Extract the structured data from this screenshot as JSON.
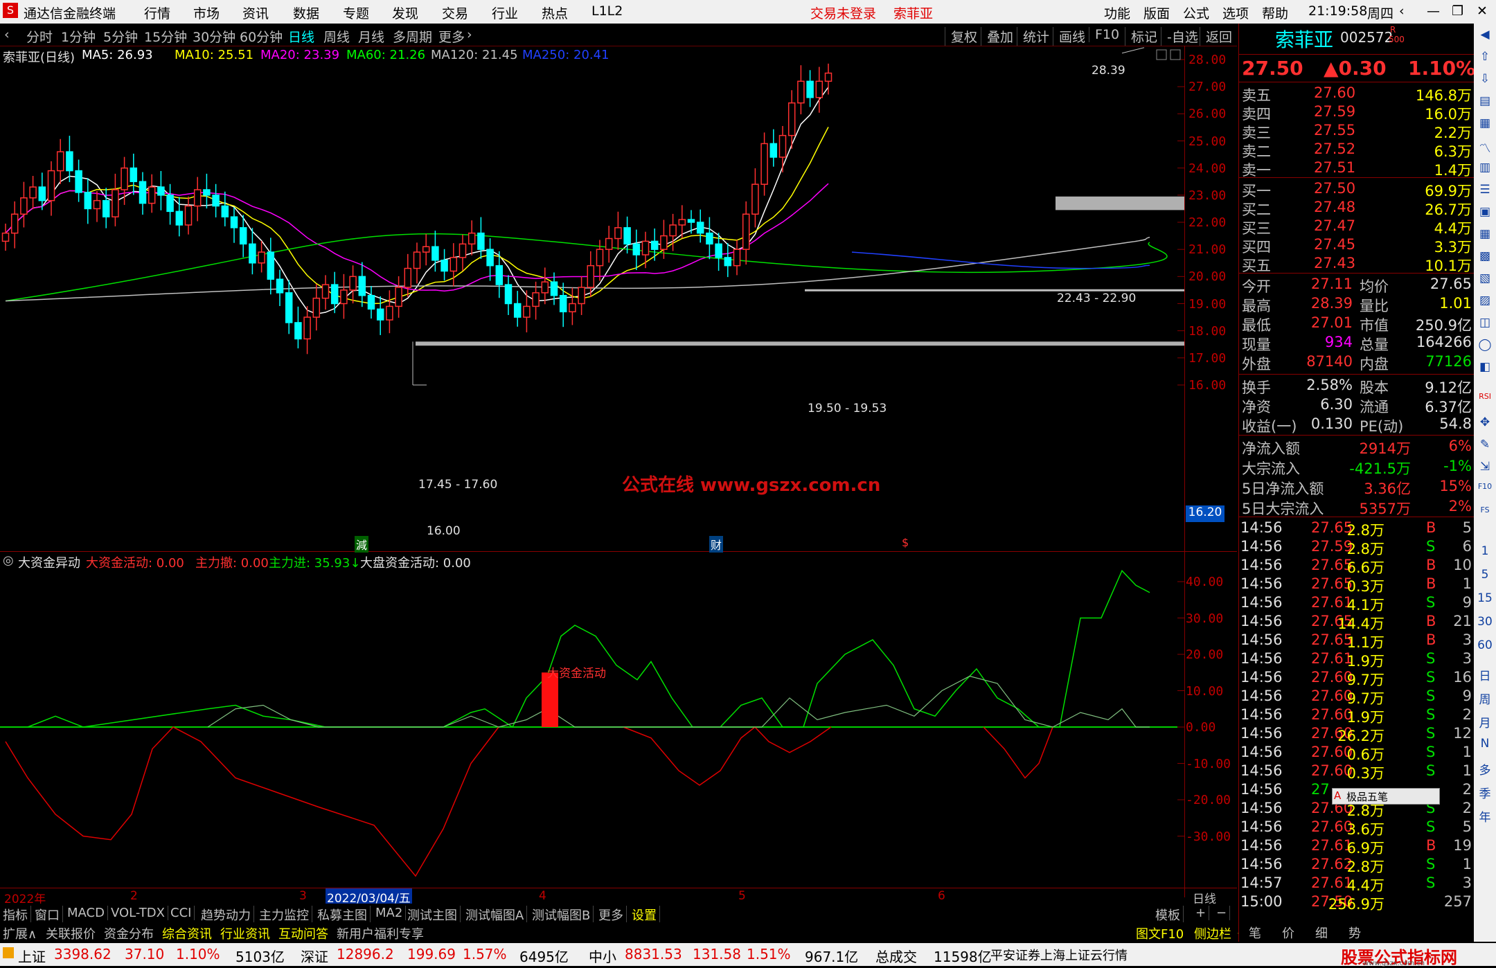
{
  "window": {
    "app_name": "通达信金融终端",
    "menu": [
      "行情",
      "市场",
      "资讯",
      "数据",
      "专题",
      "发现",
      "交易",
      "行业",
      "热点",
      "L1L2"
    ],
    "login_status": "交易未登录",
    "stock_name_title": "索菲亚",
    "right_menu": [
      "功能",
      "版面",
      "公式",
      "选项",
      "帮助"
    ],
    "time": "21:19:58",
    "weekday": "周四"
  },
  "period_bar": {
    "periods": [
      "分时",
      "1分钟",
      "5分钟",
      "15分钟",
      "30分钟",
      "60分钟",
      "日线",
      "周线",
      "月线",
      "多周期",
      "更多"
    ],
    "active": "日线",
    "tools": [
      "复权",
      "叠加",
      "统计",
      "画线",
      "F10",
      "标记",
      "-自选",
      "返回"
    ]
  },
  "main_chart": {
    "legend_title": "索菲亚(日线)",
    "ma": [
      {
        "label": "MA5: 26.93",
        "color": "#ffffff"
      },
      {
        "label": "MA10: 25.51",
        "color": "#ffff00"
      },
      {
        "label": "MA20: 23.39",
        "color": "#ff00ff"
      },
      {
        "label": "MA60: 21.26",
        "color": "#00ff00"
      },
      {
        "label": "MA120: 21.45",
        "color": "#c0c0c0"
      },
      {
        "label": "MA250: 20.41",
        "color": "#2040ff"
      }
    ],
    "annotations": {
      "high": "28.39",
      "zone1": "22.43 - 22.90",
      "zone2": "19.50 - 19.53",
      "zone3": "17.45 - 17.60",
      "low": "16.00",
      "watermark": "公式在线  www.gszx.com.cn",
      "current_price_tag": "16.20",
      "event_marks": [
        "減",
        "财",
        "$"
      ]
    },
    "y_ticks": [
      "28.00",
      "27.00",
      "26.00",
      "25.00",
      "24.00",
      "23.00",
      "22.00",
      "21.00",
      "20.00",
      "19.00",
      "18.00",
      "17.00",
      "16.00"
    ]
  },
  "indicator": {
    "name": "大资金异动",
    "labels": [
      {
        "text": "大资金活动: 0.00",
        "color": "#ff3030"
      },
      {
        "text": "主力撤: 0.00",
        "color": "#ff3030"
      },
      {
        "text": "主力进: 35.93↓",
        "color": "#00e000"
      },
      {
        "text": "大盘资金活动: 0.00",
        "color": "#e0e0e0"
      }
    ],
    "bar_label": "大资金活动",
    "y_ticks": [
      "40.00",
      "30.00",
      "20.00",
      "10.00",
      "0.00",
      "-10.00",
      "-20.00",
      "-30.00"
    ]
  },
  "x_axis": {
    "labels": [
      "2022年",
      "2",
      "3",
      "2022/03/04/五",
      "4",
      "5",
      "6"
    ],
    "period": "日线"
  },
  "bottom_tabs": [
    "指标",
    "窗口",
    "MACD",
    "VOL-TDX",
    "CCI",
    "趋势动力",
    "主力监控",
    "私募主图",
    "MA2",
    "测试主图",
    "测试幅图A",
    "测试幅图B",
    "更多",
    "设置",
    "模板"
  ],
  "bottom_tabs2": [
    "扩展∧",
    "关联报价",
    "资金分布",
    "综合资讯",
    "行业资讯",
    "互动问答",
    "新用户福利专享"
  ],
  "bottom_right_links": [
    "图文F10",
    "侧边栏《",
    "笔",
    "价",
    "细",
    "势"
  ],
  "status_bar": {
    "items": [
      {
        "name": "上证",
        "value": "3398.62",
        "change": "37.10",
        "pct": "1.10%",
        "amount": "5103亿"
      },
      {
        "name": "深证",
        "value": "12896.2",
        "change": "199.69",
        "pct": "1.57%",
        "amount": "6495亿"
      },
      {
        "name": "中小",
        "value": "8831.53",
        "change": "131.58",
        "pct": "1.51%",
        "amount": "967.1亿"
      }
    ],
    "total_label": "总成交",
    "total_value": "11598亿",
    "broker": "平安证券上海上证云行情",
    "brand": "股票公式指标网",
    "brand_url": "www.gszx.com.cn"
  },
  "quote_panel": {
    "name": "索菲亚",
    "code": "002572",
    "badge_r": "R",
    "badge_num": "500",
    "price": "27.50",
    "change": "▲0.30",
    "pct": "1.10%",
    "asks": [
      {
        "label": "卖五",
        "price": "27.60",
        "vol": "146.8万"
      },
      {
        "label": "卖四",
        "price": "27.59",
        "vol": "16.0万"
      },
      {
        "label": "卖三",
        "price": "27.55",
        "vol": "2.2万"
      },
      {
        "label": "卖二",
        "price": "27.52",
        "vol": "6.3万"
      },
      {
        "label": "卖一",
        "price": "27.51",
        "vol": "1.4万"
      }
    ],
    "bids": [
      {
        "label": "买一",
        "price": "27.50",
        "vol": "69.9万"
      },
      {
        "label": "买二",
        "price": "27.48",
        "vol": "26.7万"
      },
      {
        "label": "买三",
        "price": "27.47",
        "vol": "4.4万"
      },
      {
        "label": "买四",
        "price": "27.45",
        "vol": "3.3万"
      },
      {
        "label": "买五",
        "price": "27.43",
        "vol": "10.1万"
      }
    ],
    "stats": [
      {
        "l1": "今开",
        "v1": "27.11",
        "l2": "均价",
        "v2": "27.65"
      },
      {
        "l1": "最高",
        "v1": "28.39",
        "l2": "量比",
        "v2": "1.01"
      },
      {
        "l1": "最低",
        "v1": "27.01",
        "l2": "市值",
        "v2": "250.9亿"
      },
      {
        "l1": "现量",
        "v1": "934",
        "l2": "总量",
        "v2": "164266"
      },
      {
        "l1": "外盘",
        "v1": "87140",
        "l2": "内盘",
        "v2": "77126"
      }
    ],
    "finance": [
      {
        "l1": "换手",
        "v1": "2.58%",
        "l2": "股本",
        "v2": "9.12亿"
      },
      {
        "l1": "净资",
        "v1": "6.30",
        "l2": "流通",
        "v2": "6.37亿"
      },
      {
        "l1": "收益(一)",
        "v1": "0.130",
        "l2": "PE(动)",
        "v2": "54.8"
      }
    ],
    "flows": [
      {
        "label": "净流入额",
        "value": "2914万",
        "pct": "6%"
      },
      {
        "label": "大宗流入",
        "value": "-421.5万",
        "pct": "-1%"
      },
      {
        "label": "5日净流入额",
        "value": "3.36亿",
        "pct": "15%"
      },
      {
        "label": "5日大宗流入",
        "value": "5357万",
        "pct": "2%"
      }
    ],
    "ticks": [
      {
        "t": "14:56",
        "p": "27.65",
        "v": "2.8万",
        "bs": "B",
        "n": "5"
      },
      {
        "t": "14:56",
        "p": "27.59",
        "v": "2.8万",
        "bs": "S",
        "n": "6"
      },
      {
        "t": "14:56",
        "p": "27.65",
        "v": "6.6万",
        "bs": "B",
        "n": "10"
      },
      {
        "t": "14:56",
        "p": "27.65",
        "v": "0.3万",
        "bs": "B",
        "n": "1"
      },
      {
        "t": "14:56",
        "p": "27.61",
        "v": "4.1万",
        "bs": "S",
        "n": "9"
      },
      {
        "t": "14:56",
        "p": "27.65",
        "v": "14.4万",
        "bs": "B",
        "n": "21"
      },
      {
        "t": "14:56",
        "p": "27.65",
        "v": "1.1万",
        "bs": "B",
        "n": "3"
      },
      {
        "t": "14:56",
        "p": "27.61",
        "v": "1.9万",
        "bs": "S",
        "n": "3"
      },
      {
        "t": "14:56",
        "p": "27.60",
        "v": "9.7万",
        "bs": "S",
        "n": "16"
      },
      {
        "t": "14:56",
        "p": "27.60",
        "v": "9.7万",
        "bs": "S",
        "n": "9"
      },
      {
        "t": "14:56",
        "p": "27.60",
        "v": "1.9万",
        "bs": "S",
        "n": "2"
      },
      {
        "t": "14:56",
        "p": "27.60",
        "v": "26.2万",
        "bs": "S",
        "n": "12"
      },
      {
        "t": "14:56",
        "p": "27.60",
        "v": "0.6万",
        "bs": "S",
        "n": "1"
      },
      {
        "t": "14:56",
        "p": "27.60",
        "v": "0.3万",
        "bs": "S",
        "n": "1"
      },
      {
        "t": "14:56",
        "p": "27",
        "v": "",
        "bs": "",
        "n": "2"
      },
      {
        "t": "14:56",
        "p": "27.60",
        "v": "2.8万",
        "bs": "S",
        "n": "2"
      },
      {
        "t": "14:56",
        "p": "27.60",
        "v": "3.6万",
        "bs": "S",
        "n": "5"
      },
      {
        "t": "14:56",
        "p": "27.61",
        "v": "6.9万",
        "bs": "B",
        "n": "19"
      },
      {
        "t": "14:56",
        "p": "27.62",
        "v": "2.8万",
        "bs": "S",
        "n": "1"
      },
      {
        "t": "14:57",
        "p": "27.61",
        "v": "4.4万",
        "bs": "S",
        "n": "3"
      },
      {
        "t": "15:00",
        "p": "27.50",
        "v": "256.9万",
        "bs": "",
        "n": "257"
      }
    ],
    "ime_popup": "极品五笔"
  },
  "side_tools": [
    "日",
    "周",
    "月",
    "N",
    "多",
    "季",
    "年",
    "1",
    "5",
    "15",
    "30",
    "60",
    "RSI",
    "F10",
    "FS"
  ]
}
